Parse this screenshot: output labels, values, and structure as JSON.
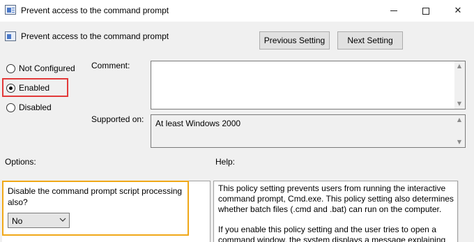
{
  "window": {
    "title": "Prevent access to the command prompt",
    "controls": {
      "minimize_icon": "minimize-icon",
      "maximize_icon": "maximize-icon",
      "close_icon": "close-icon",
      "close_glyph": "✕"
    }
  },
  "header": {
    "policy_name": "Prevent access to the command prompt",
    "prev_button": "Previous Setting",
    "next_button": "Next Setting"
  },
  "state": {
    "options": [
      {
        "label": "Not Configured",
        "checked": false
      },
      {
        "label": "Enabled",
        "checked": true
      },
      {
        "label": "Disabled",
        "checked": false
      }
    ]
  },
  "comment": {
    "label": "Comment:",
    "value": ""
  },
  "supported": {
    "label": "Supported on:",
    "value": "At least Windows 2000"
  },
  "options_section": {
    "label": "Options:",
    "description": "Disable the command prompt script processing also?",
    "select_value": "No"
  },
  "help_section": {
    "label": "Help:",
    "paragraph1": "This policy setting prevents users from running the interactive command prompt, Cmd.exe.  This policy setting also determines whether batch files (.cmd and .bat) can run on the computer.",
    "paragraph2": "If you enable this policy setting and the user tries to open a command window, the system displays a message explaining"
  },
  "highlight_colors": {
    "enabled_box": "#e23a3a",
    "options_box": "#f0a818"
  }
}
